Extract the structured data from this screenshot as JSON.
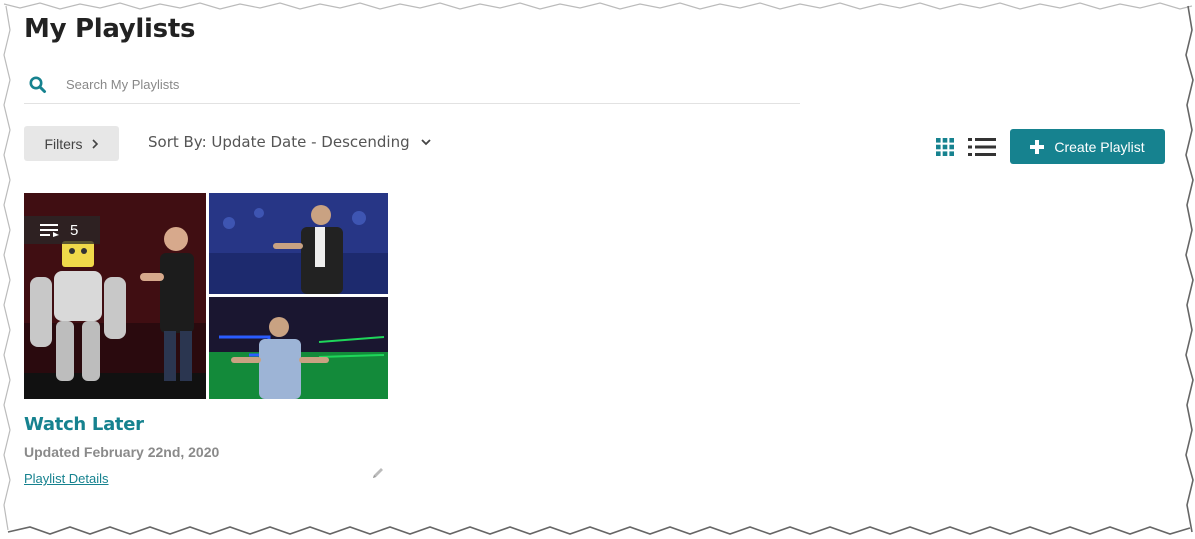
{
  "page": {
    "title": "My Playlists"
  },
  "search": {
    "placeholder": "Search My Playlists"
  },
  "toolbar": {
    "filters_label": "Filters",
    "sort_label": "Sort By: Update Date - Descending",
    "create_label": "Create Playlist",
    "view_icons": [
      "grid-view-icon",
      "list-view-icon"
    ]
  },
  "playlists": [
    {
      "title": "Watch Later",
      "updated": "Updated February 22nd, 2020",
      "details_link": "Playlist Details",
      "count": "5"
    }
  ],
  "colors": {
    "accent": "#16828f",
    "filters_bg": "#e7e7e7"
  }
}
